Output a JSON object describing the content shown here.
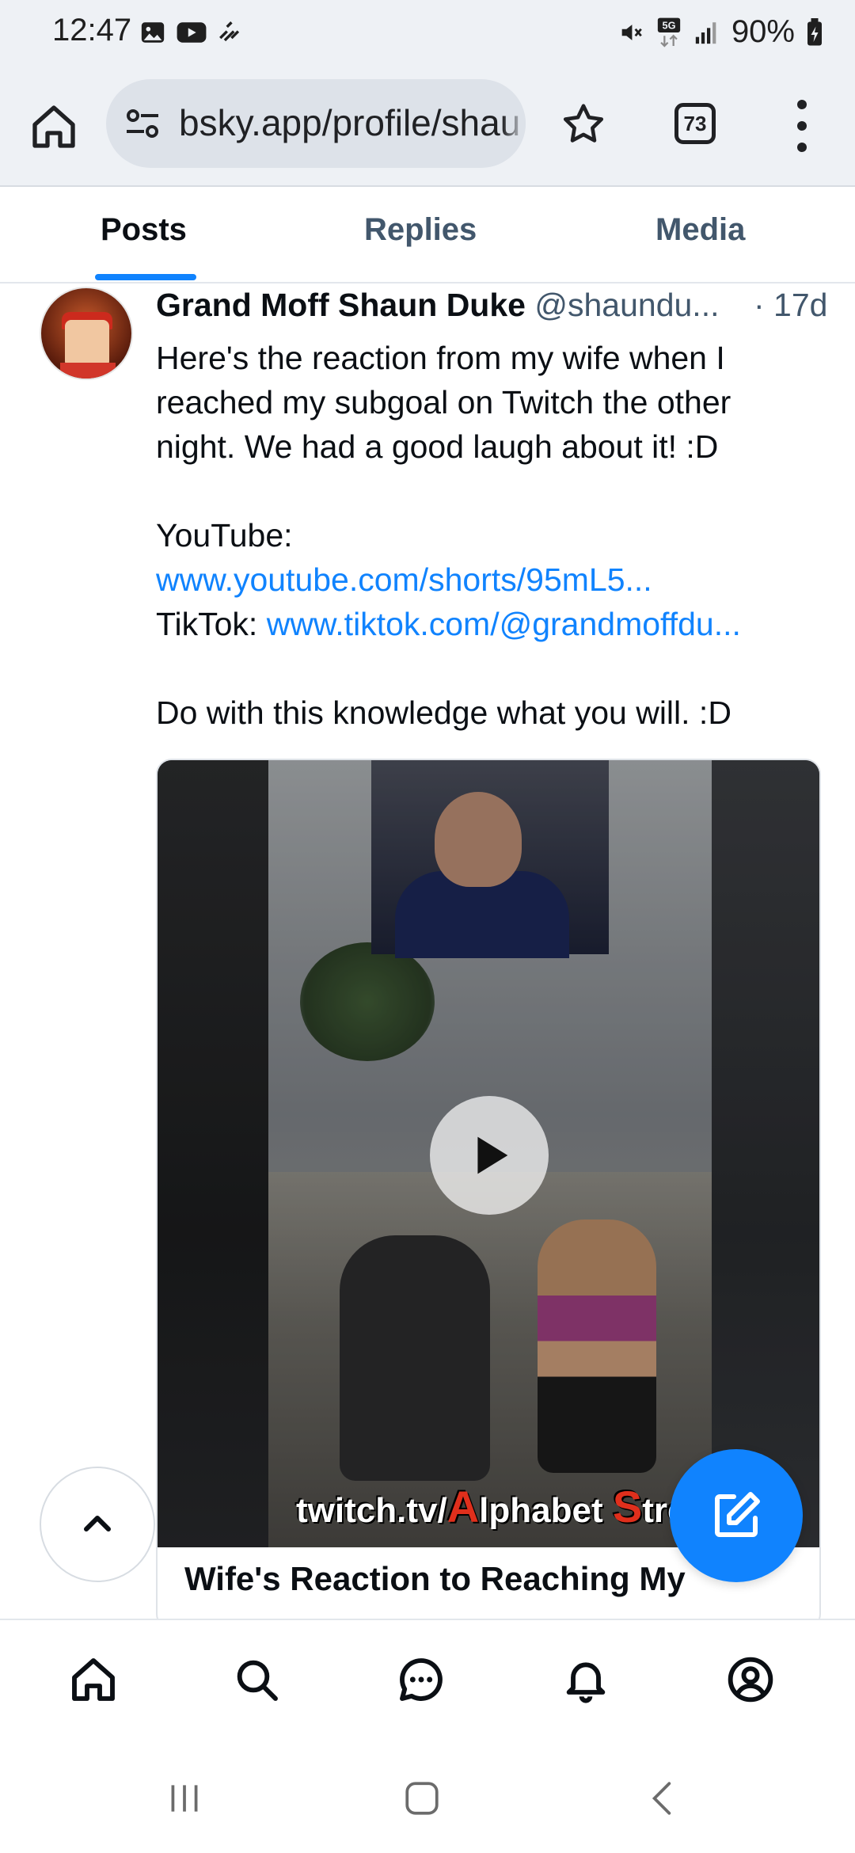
{
  "status_bar": {
    "time": "12:47",
    "battery": "90%",
    "left_icons": [
      "gallery-icon",
      "youtube-icon",
      "data-icon"
    ],
    "right_icons": [
      "mute-icon",
      "5g-icon",
      "signal-icon",
      "battery-icon"
    ]
  },
  "browser": {
    "url": "bsky.app/profile/shau",
    "tab_count": "73"
  },
  "profile_tabs": {
    "items": [
      {
        "label": "Posts",
        "active": true
      },
      {
        "label": "Replies",
        "active": false
      },
      {
        "label": "Media",
        "active": false
      }
    ]
  },
  "post": {
    "author_name": "Grand Moff Shaun Duke",
    "author_handle": "@shaundu...",
    "time": "· 17d",
    "text_line1": "Here's the reaction from my wife when I",
    "text_line2": "reached my subgoal on Twitch the other",
    "text_line3": "night. We had a good laugh about it! :D",
    "youtube_label": "YouTube:",
    "youtube_link": "www.youtube.com/shorts/95mL5...",
    "tiktok_label": "TikTok: ",
    "tiktok_link": "www.tiktok.com/@grandmoffdu...",
    "closing_text": "Do with this knowledge what you will. :D",
    "video": {
      "watermark_prefix": "twitch.tv/",
      "watermark_a": "A",
      "watermark_mid": "lphabet ",
      "watermark_s": "S",
      "watermark_end": "tream",
      "title": "Wife's Reaction to Reaching My"
    }
  },
  "colors": {
    "accent": "#1083fe",
    "text_primary": "#0b0f14",
    "text_secondary": "#42576c"
  }
}
